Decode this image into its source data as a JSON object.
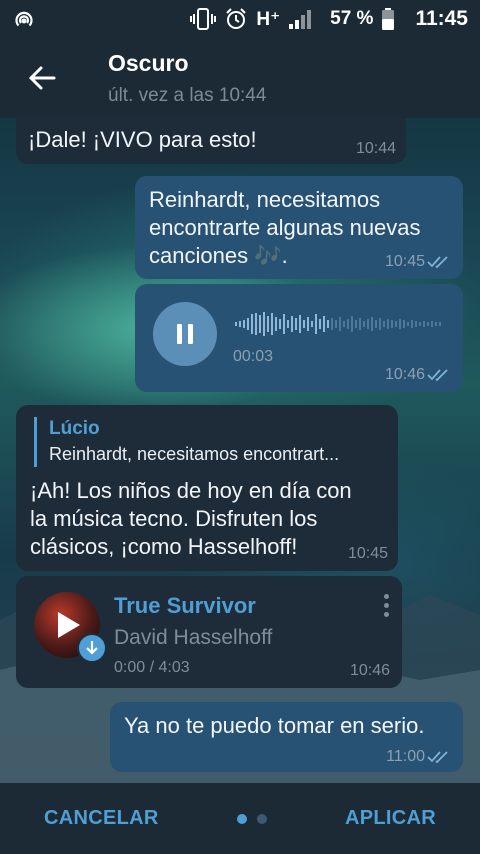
{
  "status_bar": {
    "network": "H⁺",
    "battery_percent": "57 %",
    "time": "11:45"
  },
  "header": {
    "title": "Oscuro",
    "subtitle": "últ. vez a las 10:44"
  },
  "messages": [
    {
      "text": "¡Dale! ¡VIVO para esto!",
      "time": "10:44"
    },
    {
      "text_line1": "Reinhardt, necesitamos",
      "text_line2": "encontrarte algunas nuevas",
      "text_line3": "canciones 🎶.",
      "time": "10:45"
    },
    {
      "voice_duration": "00:03",
      "time": "10:46"
    },
    {
      "reply_author": "Lúcio",
      "reply_preview": "Reinhardt, necesitamos encontrart...",
      "text_line1": "¡Ah! Los niños de hoy en día con",
      "text_line2": "la música tecno. Disfruten los",
      "text_line3": "clásicos, ¡como Hasselhoff!",
      "time": "10:45"
    },
    {
      "track_title": "True Survivor",
      "track_artist": "David Hasselhoff",
      "track_progress": "0:00 / 4:03",
      "time": "10:46"
    },
    {
      "text": "Ya no te puedo tomar en serio.",
      "time": "11:00"
    }
  ],
  "bottom": {
    "cancel_label": "CANCELAR",
    "apply_label": "APLICAR"
  },
  "colors": {
    "accent": "#4f9fd5",
    "bubble_in": "#1e2c3a",
    "bubble_out": "#285274",
    "bar_bg": "#1b2a35"
  }
}
